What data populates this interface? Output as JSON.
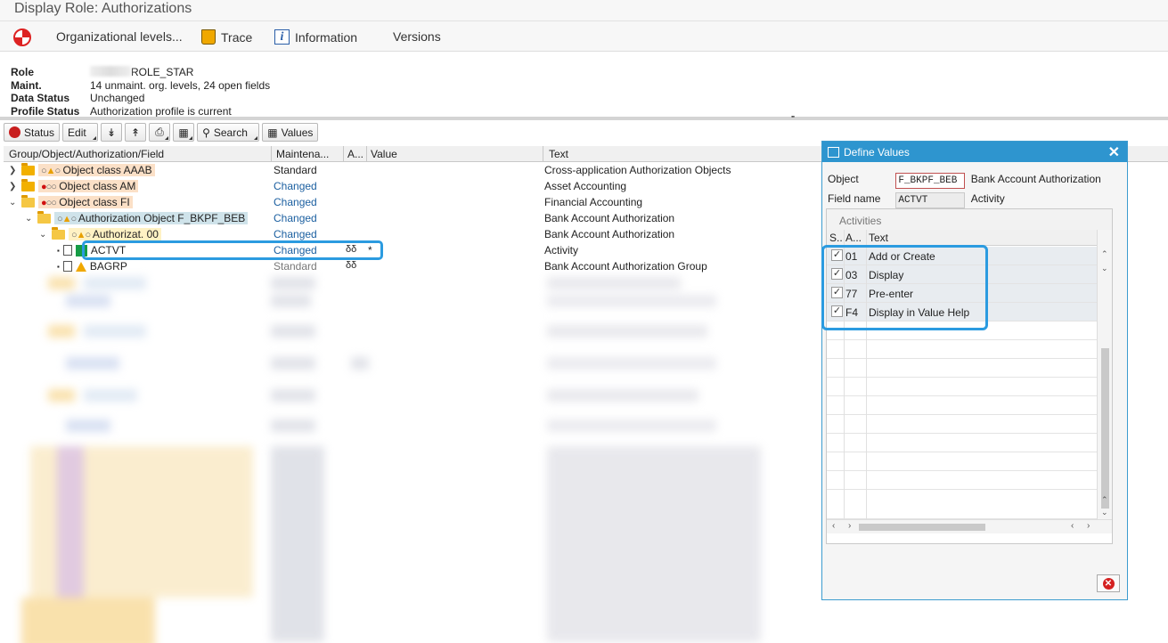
{
  "window": {
    "title": "Display Role: Authorizations"
  },
  "app_toolbar": {
    "org_levels": "Organizational levels...",
    "trace": "Trace",
    "information": "Information",
    "versions": "Versions"
  },
  "header": {
    "role_label": "Role",
    "role_value": "ROLE_STAR",
    "maint_label": "Maint.",
    "maint_value": "14 unmaint. org. levels, 24 open fields",
    "data_status_label": "Data Status",
    "data_status_value": "Unchanged",
    "profile_status_label": "Profile Status",
    "profile_status_value": "Authorization profile is current"
  },
  "grid_toolbar": {
    "status": "Status",
    "edit": "Edit",
    "search": "Search",
    "values": "Values"
  },
  "grid": {
    "columns": {
      "group": "Group/Object/Authorization/Field",
      "maint": "Maintena...",
      "flag": "A...",
      "value": "Value",
      "text": "Text"
    },
    "rows": [
      {
        "label": "Object class AAAB",
        "maint": "Standard",
        "value": "",
        "flag": "",
        "text": "Cross-application Authorization Objects"
      },
      {
        "label": "Object class AM",
        "maint": "Changed",
        "value": "",
        "flag": "",
        "text": "Asset Accounting"
      },
      {
        "label": "Object class FI",
        "maint": "Changed",
        "value": "",
        "flag": "",
        "text": "Financial Accounting"
      },
      {
        "label": "Authorization Object F_BKPF_BEB",
        "maint": "Changed",
        "value": "",
        "flag": "",
        "text": "Bank Account Authorization"
      },
      {
        "label": "Authorizat. 00",
        "maint": "Changed",
        "value": "",
        "flag": "",
        "text": "Bank Account Authorization"
      },
      {
        "label": "ACTVT",
        "maint": "Changed",
        "value": "*",
        "flag": "δδ",
        "text": "Activity"
      },
      {
        "label": "BAGRP",
        "maint": "Standard",
        "value": "",
        "flag": "δδ",
        "text": "Bank Account Authorization Group"
      }
    ]
  },
  "dialog": {
    "title": "Define Values",
    "object_label": "Object",
    "object_value": "F_BKPF_BEB",
    "object_text": "Bank Account Authorization",
    "field_label": "Field name",
    "field_value": "ACTVT",
    "field_text": "Activity",
    "table_caption": "Activities",
    "col_s": "S..",
    "col_a": "A...",
    "col_text": "Text",
    "activities": [
      {
        "code": "01",
        "text": "Add or Create",
        "checked": true
      },
      {
        "code": "03",
        "text": "Display",
        "checked": true
      },
      {
        "code": "77",
        "text": "Pre-enter",
        "checked": true
      },
      {
        "code": "F4",
        "text": "Display in Value Help",
        "checked": true
      }
    ],
    "check_mark": "✓",
    "close_glyph": "✕"
  },
  "colors": {
    "accent": "#2e95cf",
    "highlight_border": "#2b9be0",
    "changed_text": "#1b5fa0",
    "status_red": "#c81e1e"
  }
}
